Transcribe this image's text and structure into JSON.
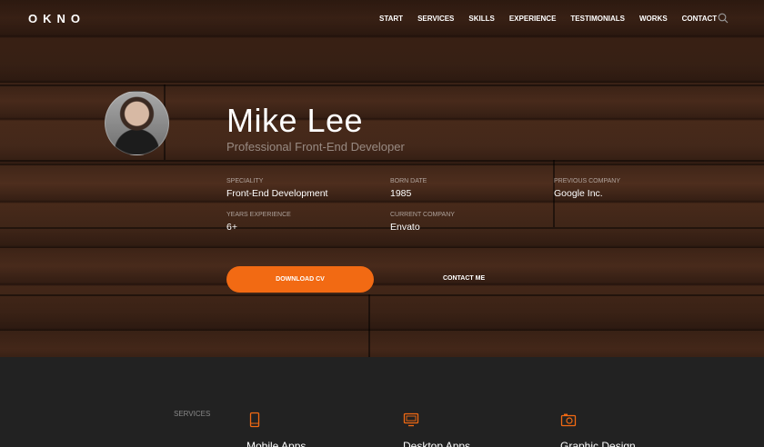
{
  "brand": {
    "logo": "OKNO",
    "accent": "#f26a13"
  },
  "nav": {
    "items": [
      "START",
      "SERVICES",
      "SKILLS",
      "EXPERIENCE",
      "TESTIMONIALS",
      "WORKS",
      "CONTACT"
    ],
    "search_icon": "search-icon"
  },
  "profile": {
    "name": "Mike Lee",
    "role": "Professional Front-End Developer",
    "info": [
      {
        "label": "SPECIALITY",
        "value": "Front-End Development"
      },
      {
        "label": "BORN DATE",
        "value": "1985"
      },
      {
        "label": "PREVIOUS COMPANY",
        "value": "Google Inc."
      },
      {
        "label": "YEARS EXPERIENCE",
        "value": "6+"
      },
      {
        "label": "CURRENT COMPANY",
        "value": "Envato"
      }
    ],
    "download_label": "DOWNLOAD CV",
    "contact_label": "CONTACT ME"
  },
  "services": {
    "label": "SERVICES",
    "items": [
      {
        "icon": "mobile-icon",
        "title": "Mobile Apps"
      },
      {
        "icon": "desktop-icon",
        "title": "Desktop Apps"
      },
      {
        "icon": "camera-icon",
        "title": "Graphic Design"
      }
    ]
  }
}
